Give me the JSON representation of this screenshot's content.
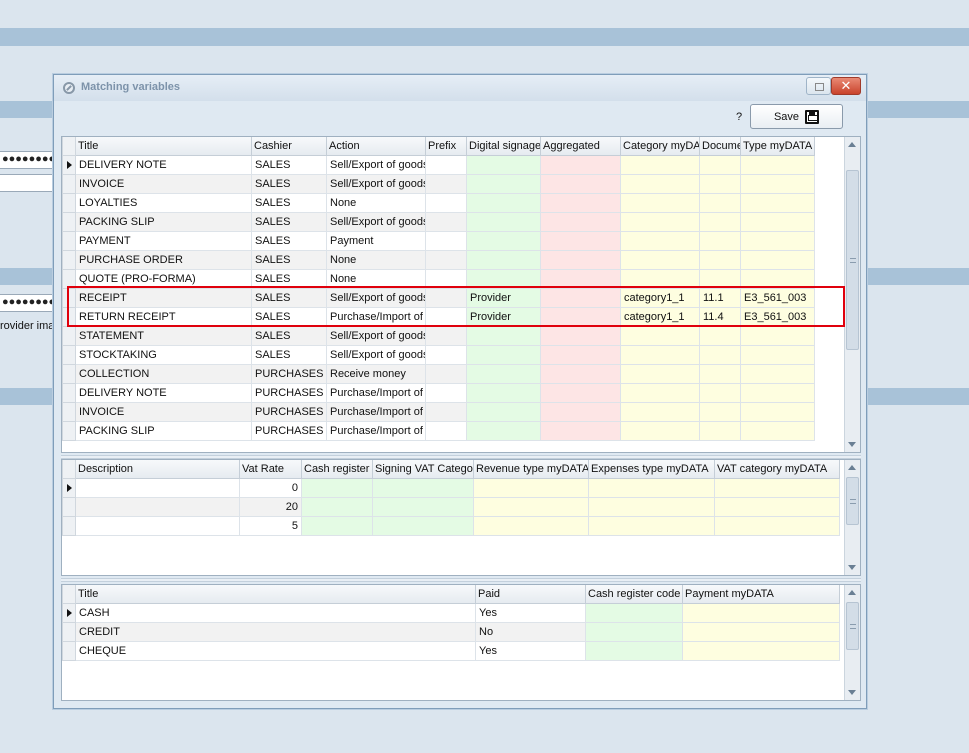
{
  "background": {
    "password_dots_1": "●●●●●●●●●●",
    "password_dots_2": "●●●●●●●●●●",
    "partial_label": "rovider ima"
  },
  "window": {
    "title": "Matching variables",
    "close_symbol": "✕",
    "help_label": "?",
    "save_label": "Save"
  },
  "documents_grid": {
    "columns": [
      "Title",
      "Cashier",
      "Action",
      "Prefix",
      "Digital signage",
      "Aggregated",
      "Category myDA",
      "Docume",
      "Type myDATA"
    ],
    "rows": [
      {
        "title": "DELIVERY NOTE",
        "cashier": "SALES",
        "action": "Sell/Export of goods",
        "prefix": "",
        "digital": "",
        "aggregated": "",
        "category": "",
        "document": "",
        "type": ""
      },
      {
        "title": "INVOICE",
        "cashier": "SALES",
        "action": "Sell/Export of goods",
        "prefix": "",
        "digital": "",
        "aggregated": "",
        "category": "",
        "document": "",
        "type": ""
      },
      {
        "title": "LOYALTIES",
        "cashier": "SALES",
        "action": "None",
        "prefix": "",
        "digital": "",
        "aggregated": "",
        "category": "",
        "document": "",
        "type": ""
      },
      {
        "title": "PACKING SLIP",
        "cashier": "SALES",
        "action": "Sell/Export of goods",
        "prefix": "",
        "digital": "",
        "aggregated": "",
        "category": "",
        "document": "",
        "type": ""
      },
      {
        "title": "PAYMENT",
        "cashier": "SALES",
        "action": "Payment",
        "prefix": "",
        "digital": "",
        "aggregated": "",
        "category": "",
        "document": "",
        "type": ""
      },
      {
        "title": "PURCHASE ORDER",
        "cashier": "SALES",
        "action": "None",
        "prefix": "",
        "digital": "",
        "aggregated": "",
        "category": "",
        "document": "",
        "type": ""
      },
      {
        "title": "QUOTE (PRO-FORMA)",
        "cashier": "SALES",
        "action": "None",
        "prefix": "",
        "digital": "",
        "aggregated": "",
        "category": "",
        "document": "",
        "type": ""
      },
      {
        "title": "RECEIPT",
        "cashier": "SALES",
        "action": "Sell/Export of goods",
        "prefix": "",
        "digital": "Provider",
        "aggregated": "",
        "category": "category1_1",
        "document": "11.1",
        "type": "E3_561_003"
      },
      {
        "title": "RETURN RECEIPT",
        "cashier": "SALES",
        "action": "Purchase/Import of",
        "prefix": "",
        "digital": "Provider",
        "aggregated": "",
        "category": "category1_1",
        "document": "11.4",
        "type": "E3_561_003"
      },
      {
        "title": "STATEMENT",
        "cashier": "SALES",
        "action": "Sell/Export of goods",
        "prefix": "",
        "digital": "",
        "aggregated": "",
        "category": "",
        "document": "",
        "type": ""
      },
      {
        "title": "STOCKTAKING",
        "cashier": "SALES",
        "action": "Sell/Export of goods",
        "prefix": "",
        "digital": "",
        "aggregated": "",
        "category": "",
        "document": "",
        "type": ""
      },
      {
        "title": "COLLECTION",
        "cashier": "PURCHASES",
        "action": "Receive money",
        "prefix": "",
        "digital": "",
        "aggregated": "",
        "category": "",
        "document": "",
        "type": ""
      },
      {
        "title": "DELIVERY NOTE",
        "cashier": "PURCHASES",
        "action": "Purchase/Import of",
        "prefix": "",
        "digital": "",
        "aggregated": "",
        "category": "",
        "document": "",
        "type": ""
      },
      {
        "title": "INVOICE",
        "cashier": "PURCHASES",
        "action": "Purchase/Import of",
        "prefix": "",
        "digital": "",
        "aggregated": "",
        "category": "",
        "document": "",
        "type": ""
      },
      {
        "title": "PACKING SLIP",
        "cashier": "PURCHASES",
        "action": "Purchase/Import of",
        "prefix": "",
        "digital": "",
        "aggregated": "",
        "category": "",
        "document": "",
        "type": ""
      }
    ]
  },
  "vat_grid": {
    "columns": [
      "Description",
      "Vat Rate",
      "Cash register",
      "Signing VAT Catego",
      "Revenue type myDATA",
      "Expenses type myDATA",
      "VAT category myDATA"
    ],
    "rows": [
      {
        "description": "",
        "vat_rate": "0",
        "cash_register": "",
        "signing": "",
        "revenue": "",
        "expenses": "",
        "vat_category": ""
      },
      {
        "description": "",
        "vat_rate": "20",
        "cash_register": "",
        "signing": "",
        "revenue": "",
        "expenses": "",
        "vat_category": ""
      },
      {
        "description": "",
        "vat_rate": "5",
        "cash_register": "",
        "signing": "",
        "revenue": "",
        "expenses": "",
        "vat_category": ""
      }
    ]
  },
  "payment_grid": {
    "columns": [
      "Title",
      "Paid",
      "Cash register code",
      "Payment myDATA"
    ],
    "rows": [
      {
        "title": "CASH",
        "paid": "Yes",
        "cash_register_code": "",
        "payment_mydata": ""
      },
      {
        "title": "CREDIT",
        "paid": "No",
        "cash_register_code": "",
        "payment_mydata": ""
      },
      {
        "title": "CHEQUE",
        "paid": "Yes",
        "cash_register_code": "",
        "payment_mydata": ""
      }
    ]
  },
  "colors": {
    "highlight_border": "#e0000c",
    "cell_green": "#e4fbe4",
    "cell_pink": "#fde5e5",
    "cell_yellow": "#fefee0"
  }
}
